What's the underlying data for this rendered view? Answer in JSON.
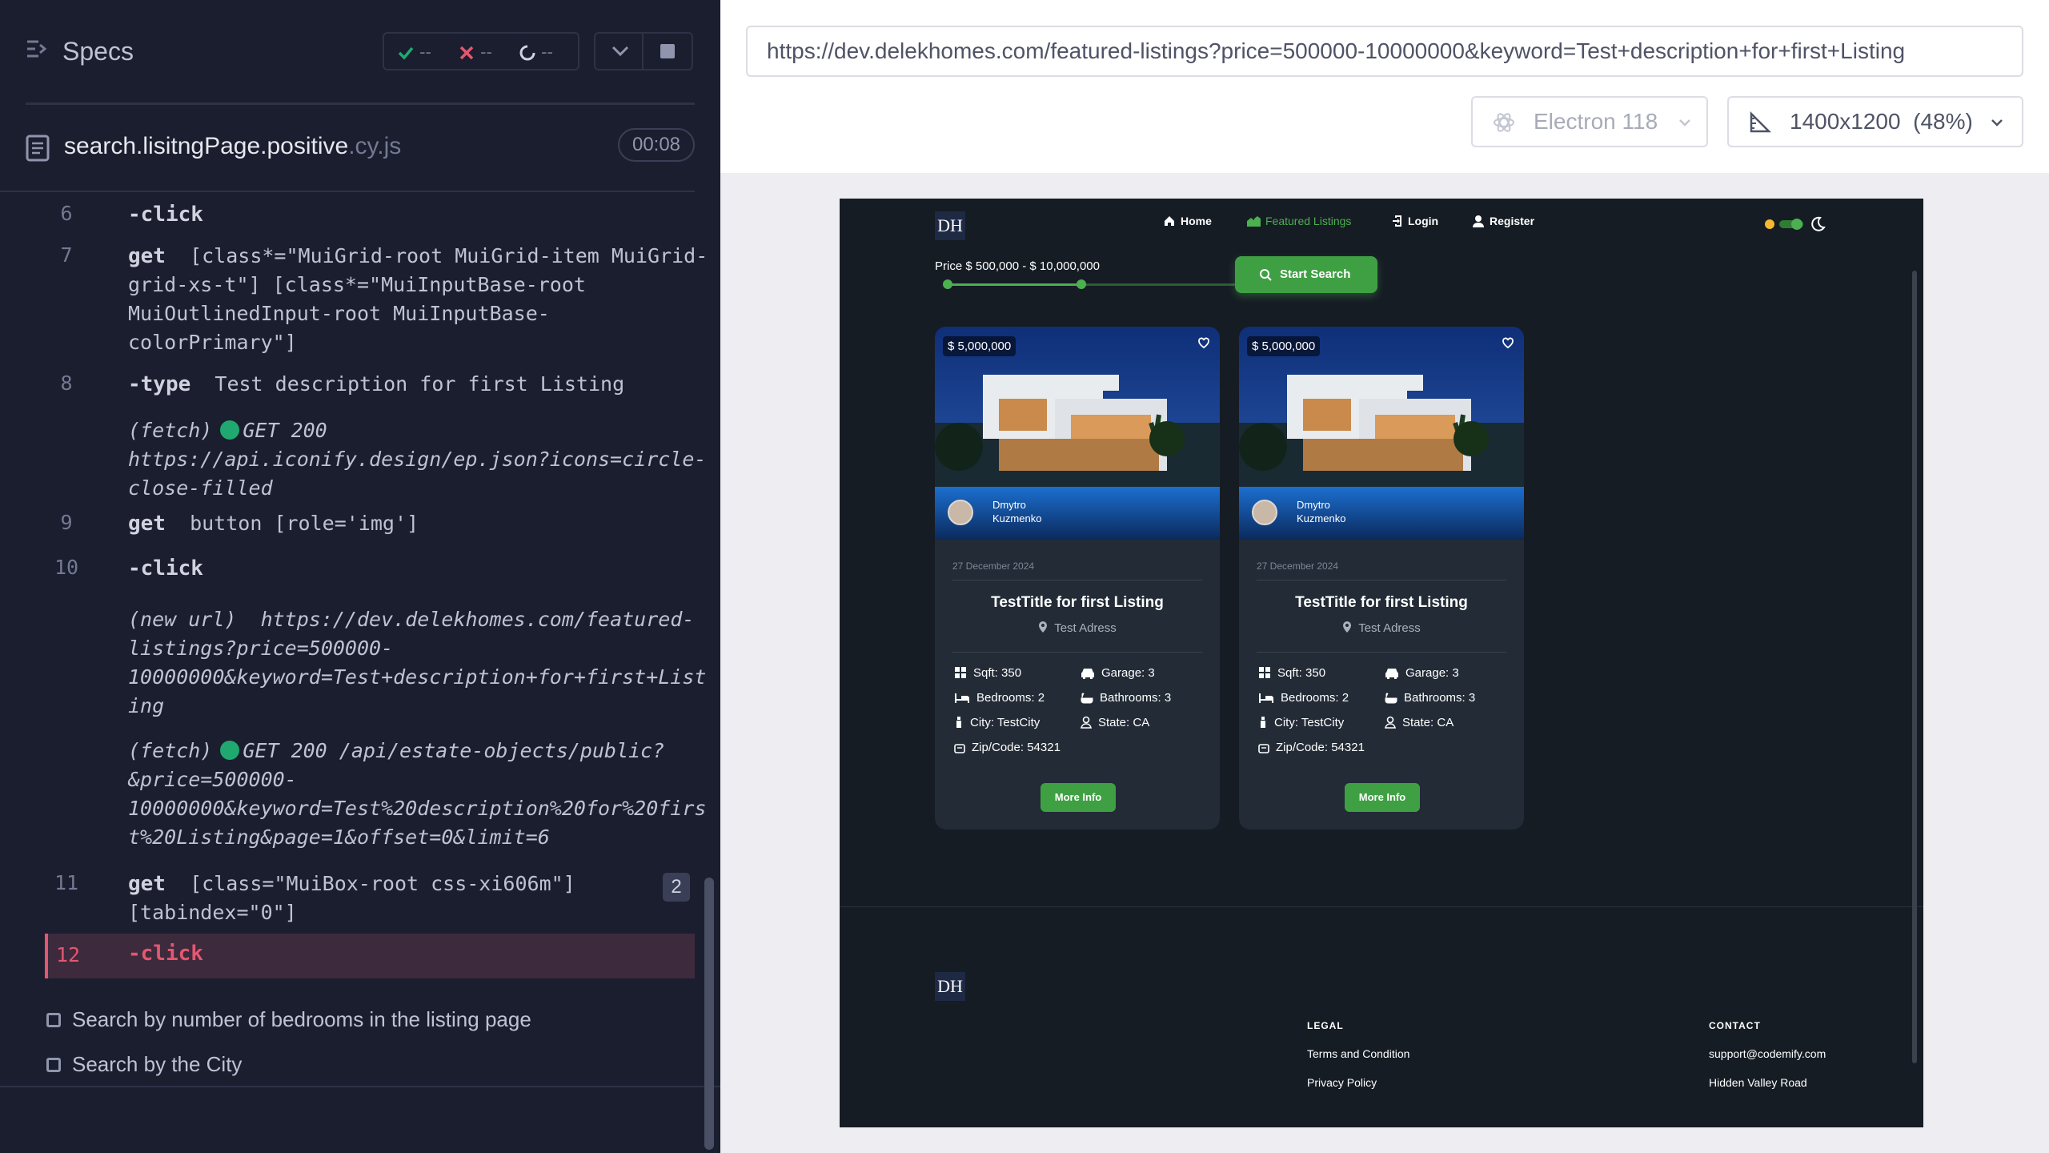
{
  "reporter": {
    "title": "Specs",
    "stats": {
      "passed": "--",
      "failed": "--",
      "pending": "--"
    },
    "file": {
      "name": "search.lisitngPage.positive",
      "ext": ".cy.js"
    },
    "timer": "00:08",
    "commands": [
      {
        "num": "6",
        "name": "-click",
        "msg": ""
      },
      {
        "num": "7",
        "name": "get",
        "msg": "[class*=\"MuiGrid-root MuiGrid-item MuiGrid-grid-xs-t\"] [class*=\"MuiInputBase-root MuiOutlinedInput-root MuiInputBase-colorPrimary\"]"
      },
      {
        "num": "8",
        "name": "-type",
        "msg": "Test description for first Listing"
      },
      {
        "num": "",
        "name": "(fetch)",
        "msg": "GET 200 https://api.iconify.design/ep.json?icons=circle-close-filled"
      },
      {
        "num": "9",
        "name": "get",
        "msg": "button [role='img']"
      },
      {
        "num": "10",
        "name": "-click",
        "msg": ""
      },
      {
        "num": "",
        "name": "(new url)",
        "msg": "https://dev.delekhomes.com/featured-listings?price=500000-10000000&keyword=Test+description+for+first+Listing"
      },
      {
        "num": "",
        "name": "(fetch)",
        "msg": "GET 200 /api/estate-objects/public?&price=500000-10000000&keyword=Test%20description%20for%20first%20Listing&page=1&offset=0&limit=6"
      },
      {
        "num": "11",
        "name": "get",
        "msg": "[class=\"MuiBox-root css-xi606m\"] [tabindex=\"0\"]"
      },
      {
        "num": "12",
        "name": "-click",
        "msg": ""
      }
    ],
    "cmd7_lines": [
      "[class*=\"MuiGrid-root MuiGrid-item MuiGrid-",
      "grid-xs-t\"] [class*=\"MuiInputBase-root",
      "MuiOutlinedInput-root MuiInputBase-",
      "colorPrimary\"]"
    ],
    "fetch1_lines": [
      "GET 200",
      "https://api.iconify.design/ep.json?icons=circle-",
      "close-filled"
    ],
    "newurl_lines": [
      "https://dev.delekhomes.com/featured-",
      "listings?price=500000-",
      "10000000&keyword=Test+description+for+first+List",
      "ing"
    ],
    "fetch2_lines": [
      "GET 200 /api/estate-objects/public?",
      "&price=500000-",
      "10000000&keyword=Test%20description%20for%20firs",
      "t%20Listing&page=1&offset=0&limit=6"
    ],
    "cmd11_lines": [
      "[class=\"MuiBox-root css-xi606m\"]",
      "[tabindex=\"0\"]"
    ],
    "count_badge": "2",
    "pending_tests": [
      "Search by number of bedrooms in the listing page",
      "Search by the City"
    ]
  },
  "browser": {
    "url": "https://dev.delekhomes.com/featured-listings?price=500000-10000000&keyword=Test+description+for+first+Listing",
    "browser_name": "Electron 118",
    "viewport": "1400x1200",
    "scale": "(48%)"
  },
  "app": {
    "logo": "DH",
    "nav": {
      "home": "Home",
      "featured": "Featured Listings",
      "login": "Login",
      "register": "Register"
    },
    "price_label": "Price $ 500,000 - $ 10,000,000",
    "price_range_fraction": [
      0.0,
      0.45
    ],
    "search_button": "Start Search",
    "cards": [
      {
        "price": "$ 5,000,000",
        "author_first": "Dmytro",
        "author_last": "Kuzmenko",
        "date": "27 December 2024",
        "title": "TestTitle for first Listing",
        "address": "Test Adress",
        "sqft": "Sqft: 350",
        "garage": "Garage: 3",
        "bedrooms": "Bedrooms: 2",
        "bathrooms": "Bathrooms: 3",
        "city": "City: TestCity",
        "state": "State: CA",
        "zip": "Zip/Code: 54321",
        "button": "More Info"
      },
      {
        "price": "$ 5,000,000",
        "author_first": "Dmytro",
        "author_last": "Kuzmenko",
        "date": "27 December 2024",
        "title": "TestTitle for first Listing",
        "address": "Test Adress",
        "sqft": "Sqft: 350",
        "garage": "Garage: 3",
        "bedrooms": "Bedrooms: 2",
        "bathrooms": "Bathrooms: 3",
        "city": "City: TestCity",
        "state": "State: CA",
        "zip": "Zip/Code: 54321",
        "button": "More Info"
      }
    ],
    "footer": {
      "logo": "DH",
      "legal_heading": "LEGAL",
      "legal_links": [
        "Terms and Condition",
        "Privacy Policy"
      ],
      "contact_heading": "CONTACT",
      "contact_lines": [
        "support@codemify.com",
        "Hidden Valley Road"
      ]
    }
  },
  "colors": {
    "accent": "#4caf50",
    "failed": "#e45770",
    "passed": "#1fa971"
  }
}
